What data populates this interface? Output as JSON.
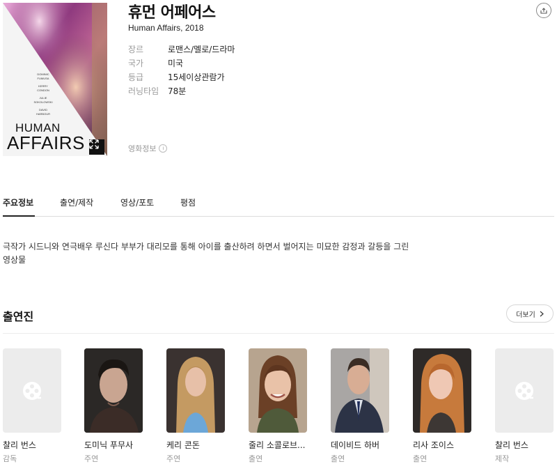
{
  "movie": {
    "title_ko": "휴먼 어페어스",
    "title_en": "Human Affairs, 2018",
    "poster": {
      "title_line1": "HUMAN",
      "title_line2": "AFFAIRS",
      "credits": [
        "DOMINIC\nFUMUSA",
        "KERRY\nCONDON",
        "JULIE\nSOKOLOWSKI",
        "DAVID\nHARBOUR"
      ]
    },
    "meta": [
      {
        "label": "장르",
        "value": "로맨스/멜로/드라마"
      },
      {
        "label": "국가",
        "value": "미국"
      },
      {
        "label": "등급",
        "value": "15세이상관람가"
      },
      {
        "label": "러닝타임",
        "value": "78분"
      }
    ],
    "info_link": "영화정보",
    "info_icon": "i"
  },
  "tabs": [
    "주요정보",
    "출연/제작",
    "영상/포토",
    "평점"
  ],
  "synopsis": "극작가 시드니와 연극배우 루신다 부부가 대리모를 통해 아이를 출산하려 하면서 벌어지는 미묘한 감정과 갈등을 그린 영상물",
  "cast_section": {
    "title": "출연진",
    "more_label": "더보기",
    "members": [
      {
        "name": "찰리 번스",
        "role": "감독",
        "photo": "placeholder",
        "icon": "film-reel-icon"
      },
      {
        "name": "도미닉 푸무사",
        "role": "주연",
        "photo": "man-dark-hair"
      },
      {
        "name": "케리 콘돈",
        "role": "주연",
        "photo": "woman-blonde"
      },
      {
        "name": "줄리 소콜로브...",
        "role": "출연",
        "photo": "woman-brown"
      },
      {
        "name": "데이비드 하버",
        "role": "출연",
        "photo": "man-suit"
      },
      {
        "name": "리사 조이스",
        "role": "출연",
        "photo": "woman-red"
      },
      {
        "name": "찰리 번스",
        "role": "제작",
        "photo": "placeholder",
        "icon": "film-reel-icon"
      }
    ]
  },
  "colors": {
    "accent_text": "#222222",
    "muted_text": "#999999",
    "divider": "#dcdcdc"
  }
}
